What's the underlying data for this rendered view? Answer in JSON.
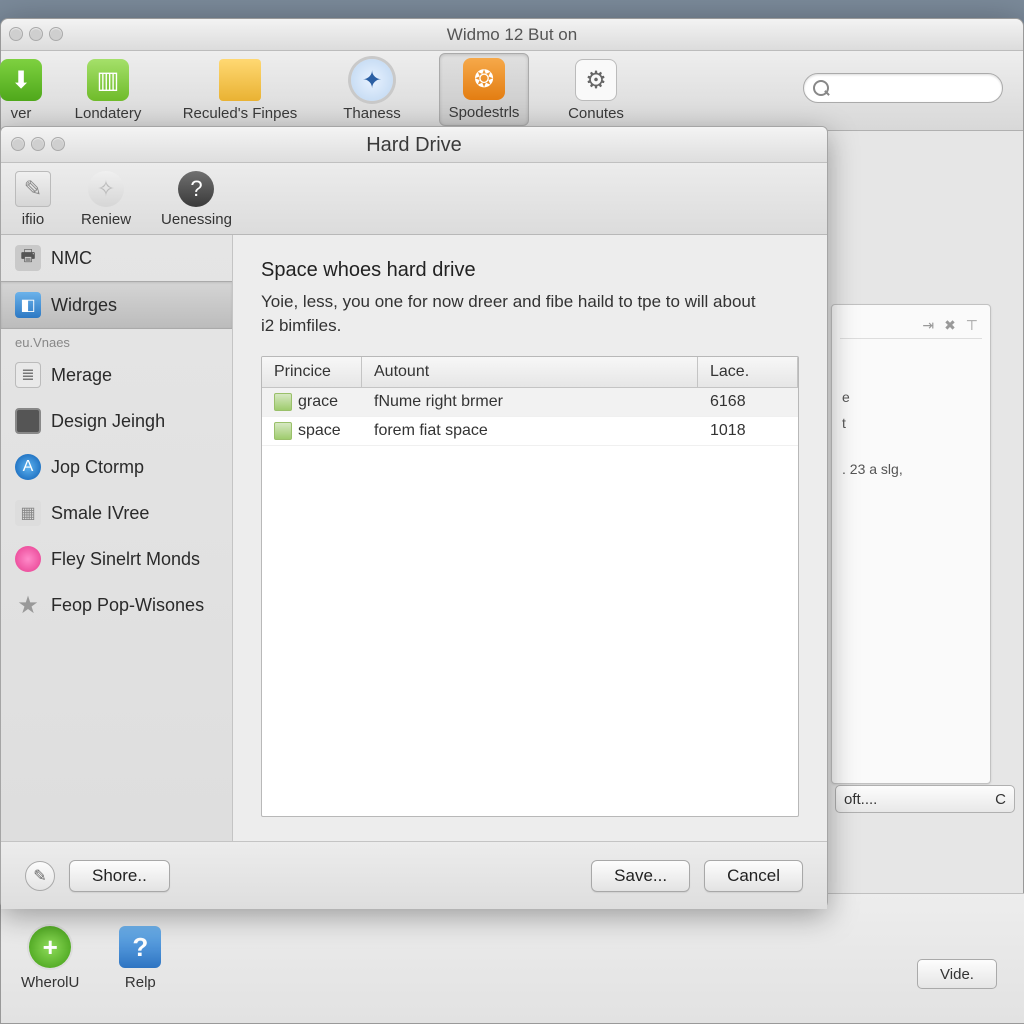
{
  "main_window": {
    "title": "Widmo 12 But on",
    "toolbar": [
      {
        "label": "ver",
        "name": "tb-ver",
        "icon": "ic-green"
      },
      {
        "label": "Londatery",
        "name": "tb-londatery",
        "icon": "ic-green2"
      },
      {
        "label": "Reculed's Finpes",
        "name": "tb-reculeds",
        "icon": "ic-folder"
      },
      {
        "label": "Thaness",
        "name": "tb-thaness",
        "icon": "ic-safari"
      },
      {
        "label": "Spodestrls",
        "name": "tb-spodestrls",
        "icon": "ic-orange",
        "selected": true
      },
      {
        "label": "Conutes",
        "name": "tb-conutes",
        "icon": "ic-sys"
      }
    ],
    "search_placeholder": "",
    "bg_panel": {
      "snippet1": "e",
      "snippet2": "t",
      "snippet3": ". 23 a slg,"
    },
    "bg_dropdown": {
      "label": "oft....",
      "right": "C"
    },
    "bottom": [
      {
        "label": "WherolU",
        "name": "bottom-wherolu"
      },
      {
        "label": "Relp",
        "name": "bottom-relp"
      }
    ],
    "vide_btn": "Vide."
  },
  "sheet": {
    "title": "Hard Drive",
    "tools": [
      {
        "label": "ifiio",
        "name": "tool-ifilo",
        "icon": "t-doc"
      },
      {
        "label": "Reniew",
        "name": "tool-reniew",
        "icon": "t-bulb"
      },
      {
        "label": "Uenessing",
        "name": "tool-uenessing",
        "icon": "t-help"
      }
    ],
    "sidebar": {
      "heading": "eu.Vnaes",
      "items": [
        {
          "label": "NMC",
          "name": "side-nmc",
          "icon": "si-printer"
        },
        {
          "label": "Widrges",
          "name": "side-widrges",
          "icon": "si-widget",
          "selected": true
        },
        {
          "label": "Merage",
          "name": "side-merage",
          "icon": "si-doc"
        },
        {
          "label": "Design Jeingh",
          "name": "side-design",
          "icon": "si-screen"
        },
        {
          "label": "Jop Ctormp",
          "name": "side-jop",
          "icon": "si-blue"
        },
        {
          "label": "Smale IVree",
          "name": "side-smale",
          "icon": "si-grid"
        },
        {
          "label": "Fley Sinelrt Monds",
          "name": "side-fley",
          "icon": "si-flower"
        },
        {
          "label": "Feop Pop-Wisones",
          "name": "side-feop",
          "icon": "si-star"
        }
      ]
    },
    "content": {
      "heading": "Space whoes hard drive",
      "desc": "Yoie, less, you one for now dreer and fibe haild to tpe to will about i2 bimfiles.",
      "columns": [
        "Princice",
        "Autount",
        "Lace."
      ],
      "rows": [
        {
          "c1": "grace",
          "c2": "fNume right brmer",
          "c3": "6168",
          "selected": true
        },
        {
          "c1": "space",
          "c2": "forem fiat space",
          "c3": "1018"
        }
      ]
    },
    "footer": {
      "shore": "Shore..",
      "save": "Save...",
      "cancel": "Cancel"
    }
  }
}
